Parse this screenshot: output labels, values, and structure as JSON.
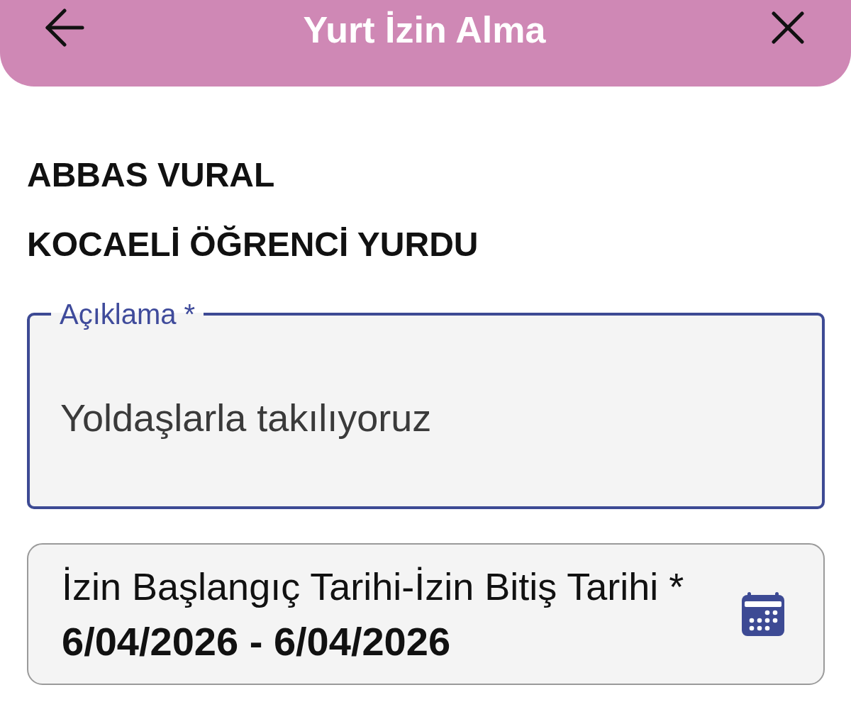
{
  "header": {
    "title": "Yurt İzin Alma"
  },
  "student": {
    "name": "ABBAS VURAL",
    "dormitory": "KOCAELİ ÖĞRENCİ YURDU"
  },
  "fields": [
    {
      "kind": "textarea",
      "label": "Açıklama *",
      "value": "Yoldaşlarla takılıyoruz",
      "focused": true
    },
    {
      "kind": "date_range",
      "label": "İzin Başlangıç Tarihi-İzin Bitiş Tarihi *",
      "value": "6/04/2026 - 6/04/2026",
      "focused": false
    }
  ]
}
